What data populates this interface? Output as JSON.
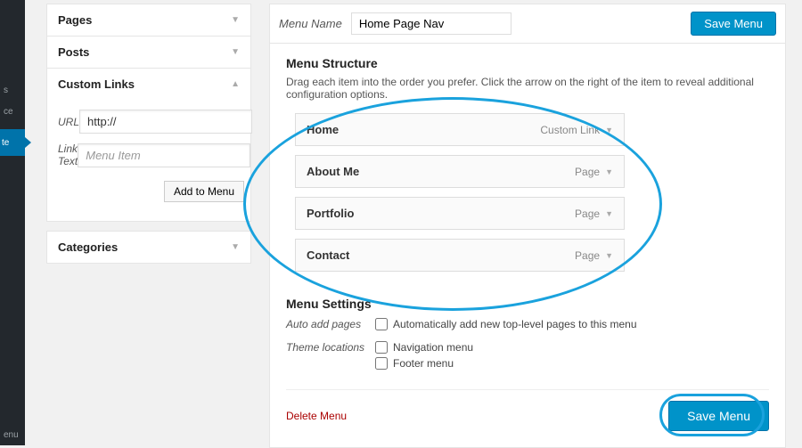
{
  "admin_nav": {
    "active_item": "te",
    "stub_s": "s",
    "stub_ce": "ce",
    "stub_enu": "enu"
  },
  "left_panels": {
    "pages_label": "Pages",
    "posts_label": "Posts",
    "custom_links_label": "Custom Links",
    "categories_label": "Categories"
  },
  "custom_links": {
    "url_label": "URL",
    "url_value": "http://",
    "linktext_label": "Link Text",
    "linktext_placeholder": "Menu Item",
    "add_button": "Add to Menu"
  },
  "menu_name": {
    "label": "Menu Name",
    "value": "Home Page Nav"
  },
  "save_button": "Save Menu",
  "structure": {
    "heading": "Menu Structure",
    "help": "Drag each item into the order you prefer. Click the arrow on the right of the item to reveal additional configuration options.",
    "items": [
      {
        "title": "Home",
        "type": "Custom Link"
      },
      {
        "title": "About Me",
        "type": "Page"
      },
      {
        "title": "Portfolio",
        "type": "Page"
      },
      {
        "title": "Contact",
        "type": "Page"
      }
    ]
  },
  "settings": {
    "heading": "Menu Settings",
    "auto_add_label": "Auto add pages",
    "auto_add_option": "Automatically add new top-level pages to this menu",
    "theme_loc_label": "Theme locations",
    "theme_loc_options": [
      "Navigation menu",
      "Footer menu"
    ]
  },
  "delete_label": "Delete Menu",
  "save_button_bottom": "Save Menu"
}
